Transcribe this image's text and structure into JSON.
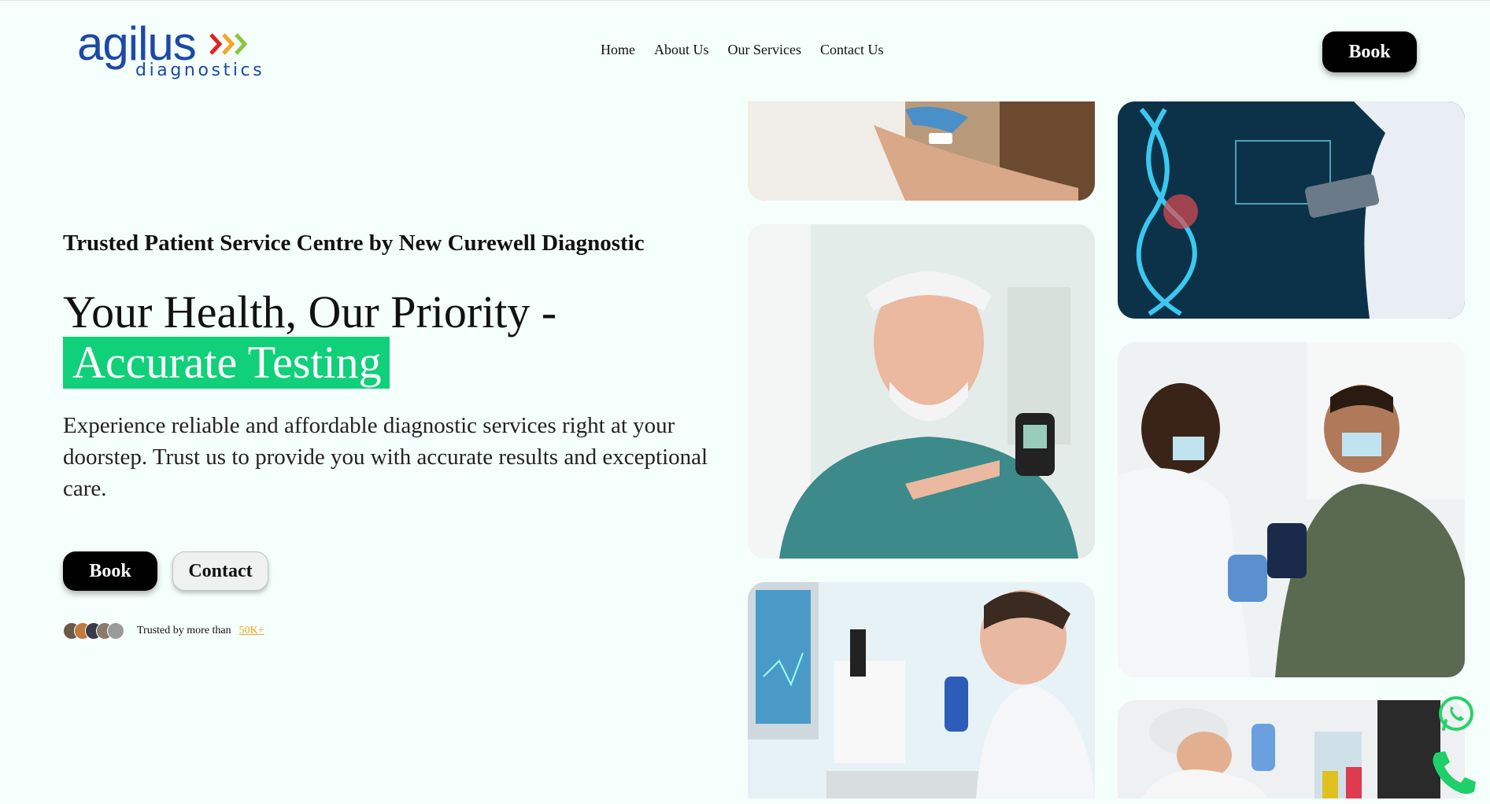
{
  "header": {
    "logo_word": "agilus",
    "logo_sub": "diagnostics",
    "nav": [
      "Home",
      "About Us",
      "Our Services",
      "Contact Us"
    ],
    "book_label": "Book"
  },
  "hero": {
    "eyebrow": "Trusted Patient Service Centre by New Curewell Diagnostic",
    "headline_1": "Your Health, Our Priority -",
    "headline_2": "Accurate Testing",
    "description": "Experience reliable and affordable diagnostic services right at your doorstep. Trust us to provide you with accurate results and exceptional care.",
    "book_label": "Book",
    "contact_label": "Contact",
    "trusted_prefix": "Trusted by more than",
    "trusted_count": "50K+"
  },
  "colors": {
    "accent_green": "#10d07a",
    "brand_blue": "#1c49a8",
    "link_orange": "#f0a71e"
  },
  "icons": [
    "whatsapp-icon",
    "phone-icon"
  ]
}
